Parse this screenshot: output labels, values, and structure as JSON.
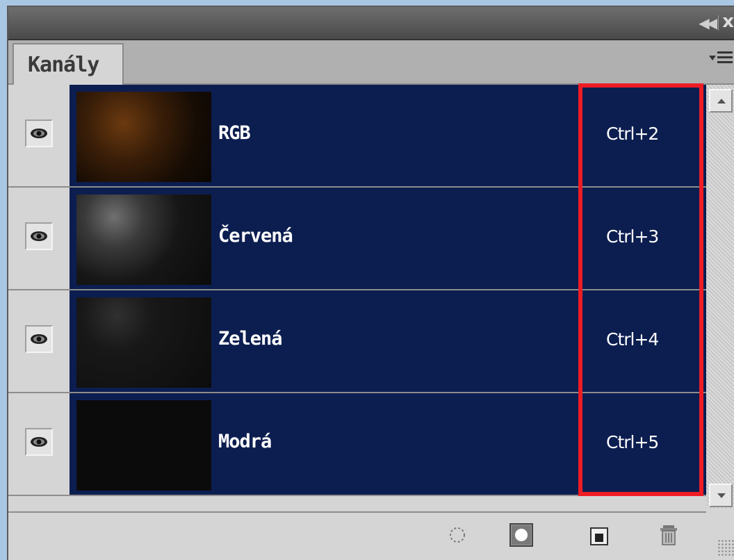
{
  "panel": {
    "tab_label": "Kanály",
    "collapse_icon": "collapse-double-arrow-icon",
    "close_icon": "close-icon",
    "menu_icon": "panel-menu-icon"
  },
  "channels": [
    {
      "name": "RGB",
      "shortcut": "Ctrl+2",
      "visible": true,
      "selected": true,
      "thumb_tint": "#6b3a10"
    },
    {
      "name": "Červená",
      "shortcut": "Ctrl+3",
      "visible": true,
      "selected": true,
      "thumb_tint": "#707070"
    },
    {
      "name": "Zelená",
      "shortcut": "Ctrl+4",
      "visible": true,
      "selected": true,
      "thumb_tint": "#303030"
    },
    {
      "name": "Modrá",
      "shortcut": "Ctrl+5",
      "visible": true,
      "selected": true,
      "thumb_tint": "#181818"
    }
  ],
  "footer": {
    "buttons": [
      "load-channel-as-selection-icon",
      "save-selection-as-channel-icon",
      "new-channel-icon",
      "delete-channel-icon"
    ]
  },
  "colors": {
    "selected_row": "#0c1e50",
    "highlight": "#ee1c24",
    "panel_bg": "#d5d5d5"
  }
}
